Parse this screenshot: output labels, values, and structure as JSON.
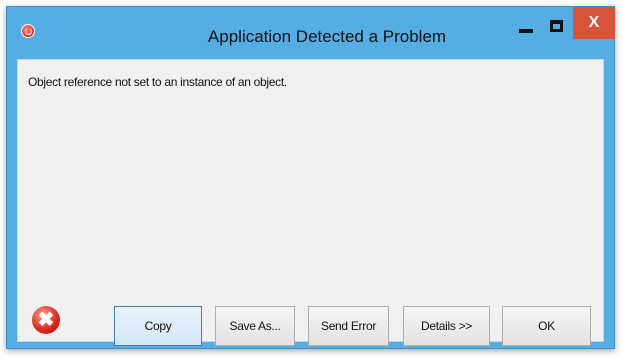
{
  "window": {
    "title": "Application Detected a Problem",
    "close_glyph": "X"
  },
  "message": "Object reference not set to an instance of an object.",
  "buttons": {
    "copy": "Copy",
    "save_as": "Save As...",
    "send_error": "Send Error",
    "details": "Details >>",
    "ok": "OK"
  },
  "icons": {
    "app": "app-error-icon",
    "error": "error-icon",
    "error_glyph": "✖"
  },
  "colors": {
    "titlebar": "#55aee3",
    "close_button": "#d9533b",
    "client_background": "#f0f0f0",
    "error_red": "#d8261c"
  }
}
